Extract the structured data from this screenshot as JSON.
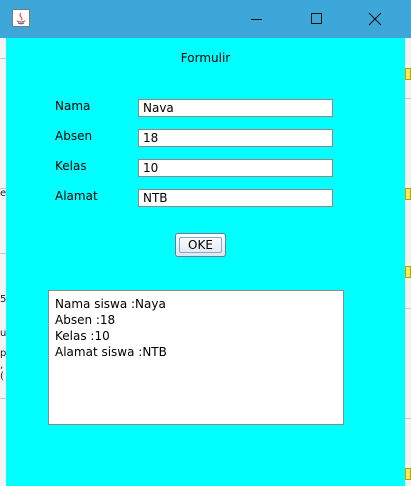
{
  "window": {
    "title": "",
    "controls": [
      "minimize-icon",
      "maximize-icon",
      "close-icon"
    ]
  },
  "form": {
    "title": "Formulir",
    "fields": [
      {
        "label": "Nama",
        "value": "Nava"
      },
      {
        "label": "Absen",
        "value": "18"
      },
      {
        "label": "Kelas",
        "value": "10"
      },
      {
        "label": "Alamat",
        "value": "NTB"
      }
    ],
    "submit_label": "OKE"
  },
  "output": {
    "lines": [
      "Nama siswa :Naya",
      "Absen :18",
      "Kelas :10",
      "Alamat siswa :NTB"
    ]
  },
  "colors": {
    "window_bg": "#00ffff",
    "titlebar_bg": "#3ca7d8"
  }
}
